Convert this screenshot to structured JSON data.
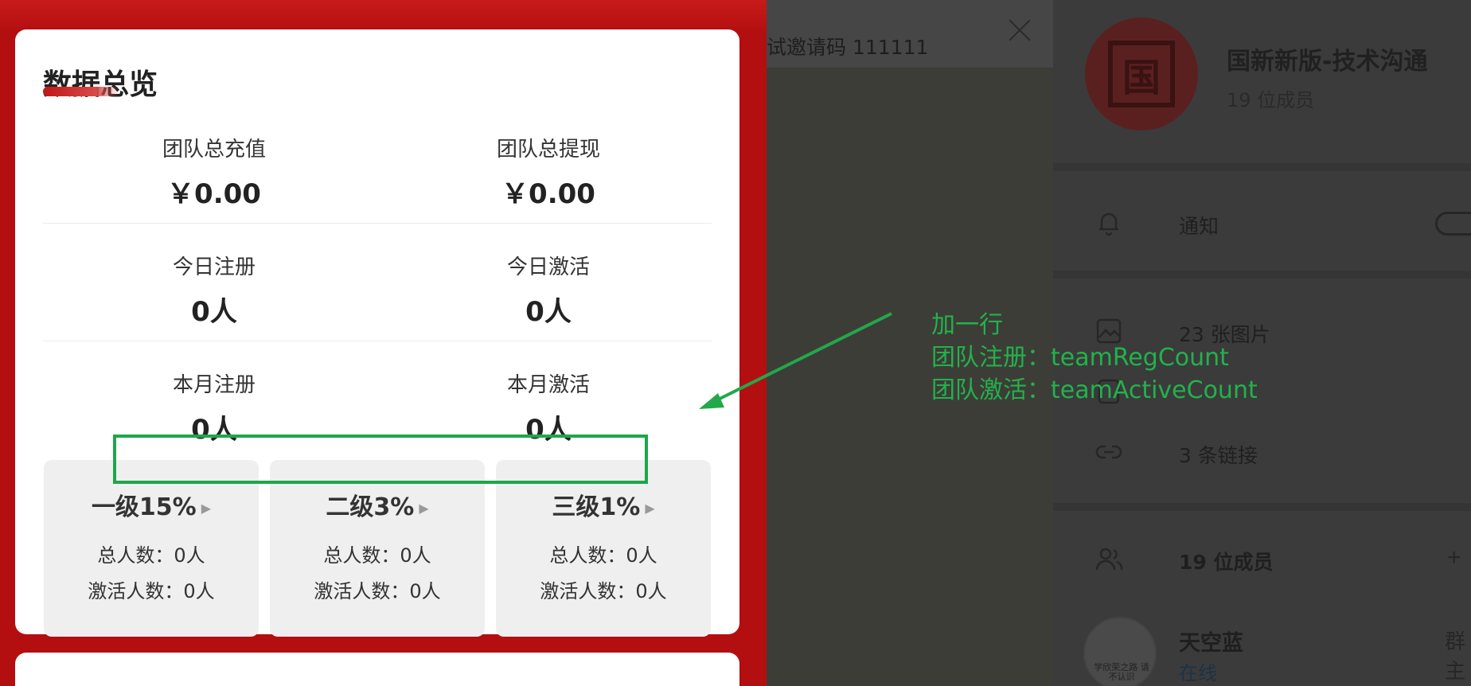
{
  "app_card": {
    "title": "数据总览",
    "stats": [
      {
        "label": "团队总充值",
        "value": "￥0.00"
      },
      {
        "label": "团队总提现",
        "value": "￥0.00"
      },
      {
        "label": "今日注册",
        "value": "0人"
      },
      {
        "label": "今日激活",
        "value": "0人"
      },
      {
        "label": "本月注册",
        "value": "0人"
      },
      {
        "label": "本月激活",
        "value": "0人"
      }
    ],
    "levels": [
      {
        "title": "一级15%",
        "total": "总人数：0人",
        "active": "激活人数：0人"
      },
      {
        "title": "二级3%",
        "total": "总人数：0人",
        "active": "激活人数：0人"
      },
      {
        "title": "三级1%",
        "total": "总人数：0人",
        "active": "激活人数：0人"
      }
    ],
    "play_glyph": "▶"
  },
  "middle": {
    "header_text": "试邀请码 111111"
  },
  "group_panel": {
    "name": "国新新版-技术沟通",
    "member_count": "19 位成员",
    "avatar_glyph": "国",
    "rows": {
      "notify": "通知",
      "images": "23 张图片",
      "links": "3 条链接",
      "members": "19 位成员"
    },
    "add_glyph": "+",
    "member": {
      "name": "天空蓝",
      "status": "在线",
      "role": "群主",
      "avatar_caption": "学欣荣之路 请不认识"
    }
  },
  "annotation": {
    "lines": [
      "加一行",
      "团队注册：teamRegCount",
      "团队激活：teamActiveCount"
    ],
    "color": "#22b24c"
  }
}
